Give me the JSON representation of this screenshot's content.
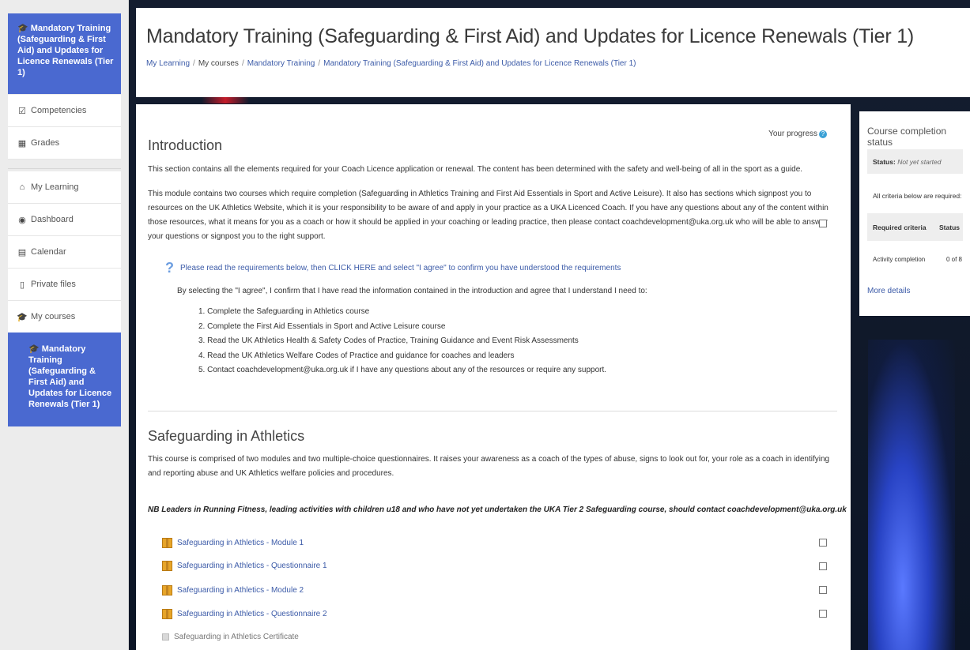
{
  "sidebar": {
    "course_block_label": "Mandatory Training (Safeguarding & First Aid) and Updates for Licence Renewals (Tier 1)",
    "items": [
      {
        "label": "Competencies",
        "icon": "check-square-icon"
      },
      {
        "label": "Grades",
        "icon": "table-icon"
      },
      {
        "label": "My Learning",
        "icon": "home-icon"
      },
      {
        "label": "Dashboard",
        "icon": "dashboard-icon"
      },
      {
        "label": "Calendar",
        "icon": "calendar-icon"
      },
      {
        "label": "Private files",
        "icon": "file-icon"
      },
      {
        "label": "My courses",
        "icon": "graduation-cap-icon"
      }
    ],
    "active_course_label": "Mandatory Training (Safeguarding & First Aid) and Updates for Licence Renewals (Tier 1)"
  },
  "header": {
    "title": "Mandatory Training (Safeguarding & First Aid) and Updates for Licence Renewals (Tier 1)",
    "breadcrumb": [
      "My Learning",
      "My courses",
      "Mandatory Training",
      "Mandatory Training (Safeguarding & First Aid) and Updates for Licence Renewals (Tier 1)"
    ]
  },
  "main": {
    "progress_label": "Your progress",
    "intro": {
      "title": "Introduction",
      "p1": "This section contains all the elements required for your Coach Licence application or renewal. The content has been determined with the safety and well-being of all in the sport as a guide.",
      "p2": "This module contains two courses which require completion (Safeguarding in Athletics Training and First Aid Essentials in Sport and Active Leisure). It also has sections which signpost you to resources on the UK Athletics Website, which it is your responsibility to be aware of and apply in your practice as a UKA Licenced Coach. If you have any questions about any of the content within those resources, what it means for you as a coach or how it should be applied in your coaching or leading practice, then please contact coachdevelopment@uka.org.uk who will be able to answer your questions or signpost you to the right support.",
      "requirement_link": "Please read the requirements below, then CLICK HERE and select \"I agree\" to confirm you have understood the requirements",
      "agree_text": "By selecting the \"I agree\", I confirm that I have read the information contained in the introduction and agree that I understand I need to:",
      "list": [
        "1. Complete the Safeguarding in Athletics course",
        "2. Complete the First Aid Essentials in Sport and Active Leisure course",
        "3. Read the UK Athletics Health & Safety Codes of Practice, Training Guidance and Event Risk Assessments",
        "4. Read the UK Athletics Welfare Codes of Practice and guidance for coaches and leaders",
        "5. Contact coachdevelopment@uka.org.uk if I have any questions about any of the resources or require any support."
      ]
    },
    "safeguarding": {
      "title": "Safeguarding in Athletics",
      "p1": "This course is comprised of two modules and two multiple-choice questionnaires. It raises your awareness as a coach of the types of abuse, signs to look out for, your role as a coach in identifying and reporting abuse and UK Athletics welfare policies and procedures.",
      "nb": "NB Leaders in Running Fitness, leading activities with children u18 and who have not yet undertaken the UKA Tier 2 Safeguarding course, should contact coachdevelopment@uka.org.uk",
      "activities": [
        "Safeguarding in Athletics - Module 1",
        "Safeguarding in Athletics - Questionnaire 1",
        "Safeguarding in Athletics - Module 2",
        "Safeguarding in Athletics - Questionnaire 2",
        "Safeguarding in Athletics Certificate"
      ]
    }
  },
  "completion": {
    "title": "Course completion status",
    "status_label": "Status:",
    "status_value": "Not yet started",
    "all_required": "All criteria below are required:",
    "col_criteria": "Required criteria",
    "col_status": "Status",
    "row_label": "Activity completion",
    "row_value": "0 of 8",
    "more": "More details"
  },
  "colors": {
    "accent": "#4a69d0",
    "link": "#3c5ba8",
    "background": "#0b1424"
  }
}
